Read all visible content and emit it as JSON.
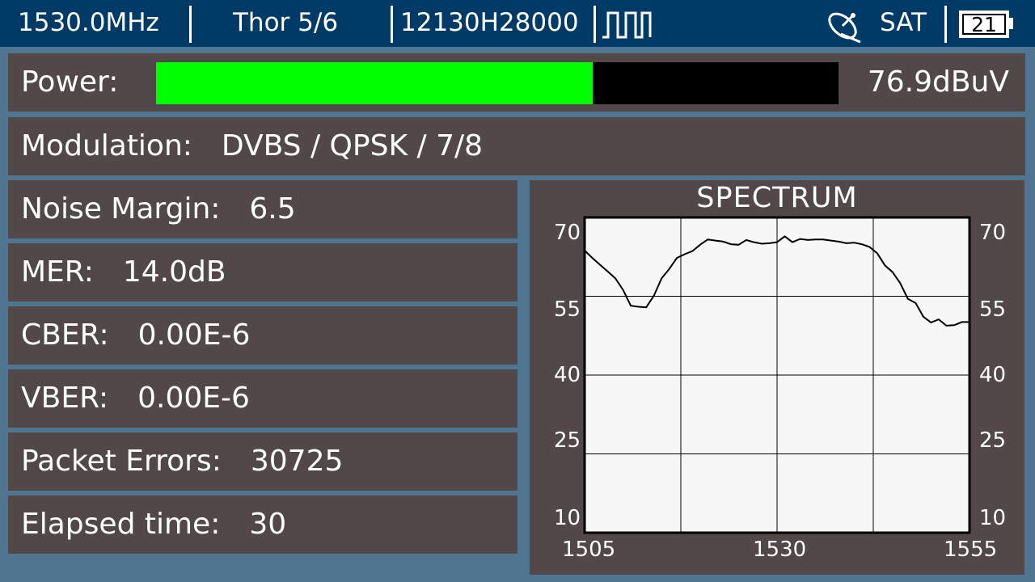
{
  "status_bar": {
    "frequency": "1530.0MHz",
    "satellite": "Thor 5/6",
    "transponder": "12130H28000",
    "pulse_icon": "square-wave-icon",
    "dish_icon": "satellite-dish-icon",
    "band": "SAT",
    "battery_level": "21"
  },
  "power": {
    "label": "Power:",
    "value": "76.9dBuV",
    "bar_fraction": 0.64,
    "bar_color": "#00ff00",
    "track_color": "#000000"
  },
  "modulation": {
    "label": "Modulation:",
    "value": "DVBS / QPSK / 7/8"
  },
  "measurements": [
    {
      "label": "Noise Margin:",
      "value": "6.5"
    },
    {
      "label": "MER:",
      "value": "14.0dB"
    },
    {
      "label": "CBER:",
      "value": "0.00E-6"
    },
    {
      "label": "VBER:",
      "value": "0.00E-6"
    },
    {
      "label": "Packet Errors:",
      "value": "30725"
    },
    {
      "label": "Elapsed time:",
      "value": "30"
    }
  ],
  "colors": {
    "background": "#4f7590",
    "top_bar": "#003a66",
    "panel": "#524848",
    "plot_background": "#f7f7f7"
  },
  "chart_data": {
    "type": "line",
    "title": "SPECTRUM",
    "xlabel": "",
    "ylabel": "",
    "xlim": [
      1505,
      1555
    ],
    "ylim": [
      10,
      70
    ],
    "x_ticks": [
      "1505",
      "1530",
      "1555"
    ],
    "y_ticks_left": [
      "70",
      "55",
      "40",
      "25",
      "10"
    ],
    "y_ticks_right": [
      "70",
      "55",
      "40",
      "25",
      "10"
    ],
    "y_tick_values": [
      70,
      55,
      40,
      25,
      10
    ],
    "x_grid": [
      1505,
      1517.5,
      1530,
      1542.5,
      1555
    ],
    "y_grid": [
      70,
      55,
      40,
      25,
      10
    ],
    "grid": true,
    "series": [
      {
        "x": [
          1505,
          1506,
          1507,
          1508,
          1509,
          1510,
          1511,
          1512,
          1513,
          1514,
          1515,
          1516,
          1517,
          1518,
          1519,
          1520,
          1521,
          1522,
          1523,
          1524,
          1525,
          1526,
          1527,
          1528,
          1529,
          1530,
          1531,
          1532,
          1533,
          1534,
          1535,
          1536,
          1537,
          1538,
          1539,
          1540,
          1541,
          1542,
          1543,
          1544,
          1545,
          1546,
          1547,
          1548,
          1549,
          1550,
          1551,
          1552,
          1553,
          1554,
          1555
        ],
        "values": [
          63.7,
          62.3,
          61.0,
          59.7,
          58.4,
          56.2,
          53.2,
          53.0,
          52.9,
          55.1,
          58.4,
          60.2,
          62.3,
          63.0,
          63.6,
          64.8,
          65.8,
          65.6,
          65.4,
          64.9,
          64.8,
          65.7,
          65.3,
          65.0,
          65.1,
          65.3,
          66.4,
          65.3,
          65.9,
          65.7,
          65.8,
          65.8,
          65.6,
          65.4,
          65.1,
          65.2,
          64.9,
          64.4,
          63.2,
          60.9,
          59.6,
          57.5,
          54.5,
          53.7,
          51.1,
          50.0,
          50.6,
          49.4,
          49.5,
          50.1,
          50.1
        ]
      }
    ]
  }
}
